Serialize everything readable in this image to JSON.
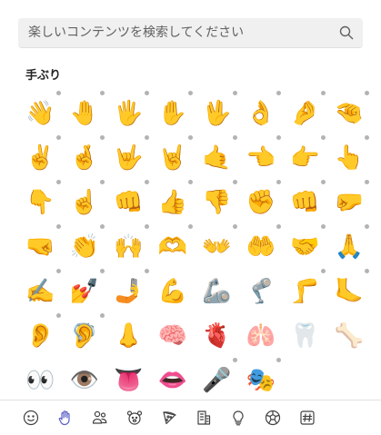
{
  "search": {
    "placeholder": "楽しいコンテンツを検索してください"
  },
  "section": {
    "title": "手ぶり"
  },
  "emojis": [
    {
      "name": "waving-hand",
      "glyph": "👋",
      "dot": true
    },
    {
      "name": "raised-back-of-hand",
      "glyph": "🤚",
      "dot": true
    },
    {
      "name": "hand-with-fingers-splayed",
      "glyph": "🖐️",
      "dot": true
    },
    {
      "name": "raised-hand",
      "glyph": "✋",
      "dot": true
    },
    {
      "name": "vulcan-salute",
      "glyph": "🖖",
      "dot": true
    },
    {
      "name": "ok-hand",
      "glyph": "👌",
      "dot": true
    },
    {
      "name": "pinched-fingers",
      "glyph": "🤌",
      "dot": true
    },
    {
      "name": "pinching-hand",
      "glyph": "🤏",
      "dot": true
    },
    {
      "name": "victory-hand",
      "glyph": "✌️",
      "dot": true
    },
    {
      "name": "crossed-fingers",
      "glyph": "🤞",
      "dot": true
    },
    {
      "name": "love-you-gesture",
      "glyph": "🤟",
      "dot": true
    },
    {
      "name": "sign-of-the-horns",
      "glyph": "🤘",
      "dot": true
    },
    {
      "name": "call-me-hand",
      "glyph": "🤙",
      "dot": true
    },
    {
      "name": "backhand-index-pointing-left",
      "glyph": "👈",
      "dot": true
    },
    {
      "name": "backhand-index-pointing-right",
      "glyph": "👉",
      "dot": true
    },
    {
      "name": "backhand-index-pointing-up",
      "glyph": "👆",
      "dot": true
    },
    {
      "name": "backhand-index-pointing-down",
      "glyph": "👇",
      "dot": true
    },
    {
      "name": "index-pointing-up",
      "glyph": "☝️",
      "dot": true
    },
    {
      "name": "oncoming-fist",
      "glyph": "👊",
      "dot": true
    },
    {
      "name": "thumbs-up",
      "glyph": "👍",
      "dot": true
    },
    {
      "name": "thumbs-down",
      "glyph": "👎",
      "dot": true
    },
    {
      "name": "raised-fist",
      "glyph": "✊",
      "dot": true
    },
    {
      "name": "oncoming-fist-front",
      "glyph": "👊",
      "dot": true
    },
    {
      "name": "left-facing-fist",
      "glyph": "🤛",
      "dot": true
    },
    {
      "name": "right-facing-fist",
      "glyph": "🤜",
      "dot": true
    },
    {
      "name": "clapping-hands",
      "glyph": "👏",
      "dot": true
    },
    {
      "name": "raising-hands",
      "glyph": "🙌",
      "dot": true
    },
    {
      "name": "heart-hands",
      "glyph": "🫶",
      "dot": true
    },
    {
      "name": "open-hands",
      "glyph": "👐",
      "dot": true
    },
    {
      "name": "palms-up-together",
      "glyph": "🤲",
      "dot": true
    },
    {
      "name": "handshake",
      "glyph": "🤝",
      "dot": true
    },
    {
      "name": "folded-hands",
      "glyph": "🙏",
      "dot": true
    },
    {
      "name": "writing-hand",
      "glyph": "✍️",
      "dot": true
    },
    {
      "name": "nail-polish",
      "glyph": "💅",
      "dot": true
    },
    {
      "name": "selfie",
      "glyph": "🤳",
      "dot": true
    },
    {
      "name": "flexed-biceps",
      "glyph": "💪",
      "dot": false
    },
    {
      "name": "mechanical-arm",
      "glyph": "🦾",
      "dot": false
    },
    {
      "name": "mechanical-leg",
      "glyph": "🦿",
      "dot": false
    },
    {
      "name": "leg",
      "glyph": "🦵",
      "dot": true
    },
    {
      "name": "foot",
      "glyph": "🦶",
      "dot": true
    },
    {
      "name": "ear",
      "glyph": "👂",
      "dot": true
    },
    {
      "name": "ear-with-hearing-aid",
      "glyph": "🦻",
      "dot": true
    },
    {
      "name": "nose",
      "glyph": "👃",
      "dot": false
    },
    {
      "name": "brain",
      "glyph": "🧠",
      "dot": false
    },
    {
      "name": "anatomical-heart",
      "glyph": "🫀",
      "dot": false
    },
    {
      "name": "lungs",
      "glyph": "🫁",
      "dot": false
    },
    {
      "name": "tooth",
      "glyph": "🦷",
      "dot": false
    },
    {
      "name": "bone",
      "glyph": "🦴",
      "dot": false
    },
    {
      "name": "eyes",
      "glyph": "👀",
      "dot": false
    },
    {
      "name": "eye",
      "glyph": "👁️",
      "dot": false
    },
    {
      "name": "tongue",
      "glyph": "👅",
      "dot": false
    },
    {
      "name": "mouth",
      "glyph": "👄",
      "dot": false
    },
    {
      "name": "microphone-hand",
      "glyph": "🎤",
      "dot": true
    },
    {
      "name": "party-mask",
      "glyph": "🎭",
      "dot": true
    }
  ],
  "toolbar": [
    {
      "name": "smileys-tab",
      "icon": "smiley-icon",
      "active": false
    },
    {
      "name": "hand-gestures-tab",
      "icon": "hand-icon",
      "active": true
    },
    {
      "name": "people-tab",
      "icon": "people-icon",
      "active": false
    },
    {
      "name": "animals-tab",
      "icon": "animal-icon",
      "active": false
    },
    {
      "name": "food-tab",
      "icon": "pizza-icon",
      "active": false
    },
    {
      "name": "places-tab",
      "icon": "building-icon",
      "active": false
    },
    {
      "name": "objects-tab",
      "icon": "lightbulb-icon",
      "active": false
    },
    {
      "name": "activities-tab",
      "icon": "soccer-ball-icon",
      "active": false
    },
    {
      "name": "symbols-tab",
      "icon": "hashtag-icon",
      "active": false
    }
  ],
  "colors": {
    "accent": "#5b5fc7",
    "search_bg": "#f0f0f0",
    "dot": "#b3b3b3"
  }
}
